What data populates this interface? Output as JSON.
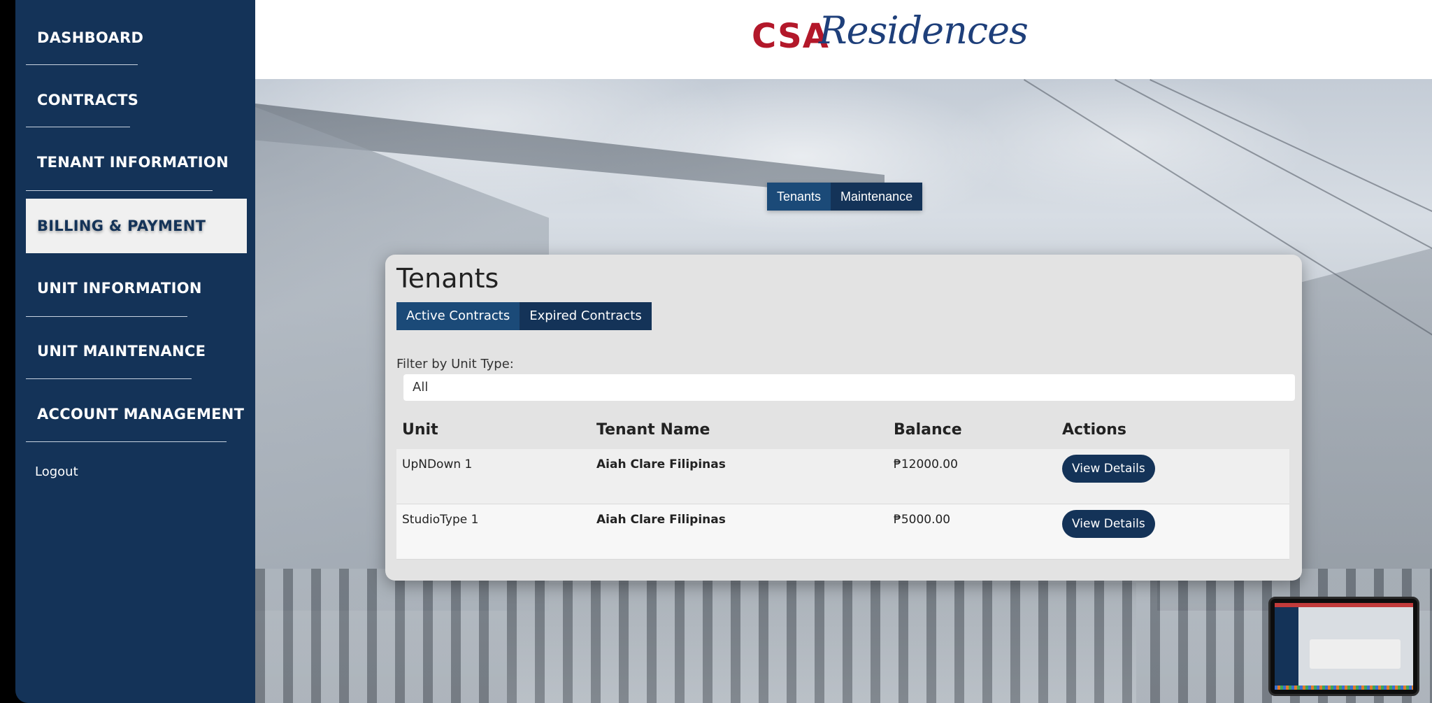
{
  "brand": {
    "part1": "CSA",
    "part2": "Residences",
    "part1_color": "#b3182a",
    "part2_color": "#1e3f7a"
  },
  "sidebar": {
    "items": [
      {
        "label": "DASHBOARD",
        "active": false
      },
      {
        "label": "CONTRACTS",
        "active": false
      },
      {
        "label": "TENANT INFORMATION",
        "active": false
      },
      {
        "label": "BILLING & PAYMENT",
        "active": true
      },
      {
        "label": "UNIT INFORMATION",
        "active": false
      },
      {
        "label": "UNIT MAINTENANCE",
        "active": false
      },
      {
        "label": "ACCOUNT MANAGEMENT",
        "active": false
      }
    ],
    "logout": "Logout",
    "color": "#143358"
  },
  "top_toggle": {
    "tenants": "Tenants",
    "maintenance": "Maintenance"
  },
  "card": {
    "title": "Tenants",
    "tabs": {
      "active": "Active Contracts",
      "expired": "Expired Contracts"
    },
    "filter": {
      "label": "Filter by Unit Type:",
      "value": "All"
    },
    "table": {
      "headers": {
        "unit": "Unit",
        "tenant": "Tenant Name",
        "balance": "Balance",
        "actions": "Actions"
      },
      "rows": [
        {
          "unit": "UpNDown 1",
          "tenant": "Aiah Clare Filipinas",
          "balance": "₱12000.00",
          "action": "View Details"
        },
        {
          "unit": "StudioType 1",
          "tenant": "Aiah Clare Filipinas",
          "balance": "₱5000.00",
          "action": "View Details"
        }
      ]
    }
  }
}
